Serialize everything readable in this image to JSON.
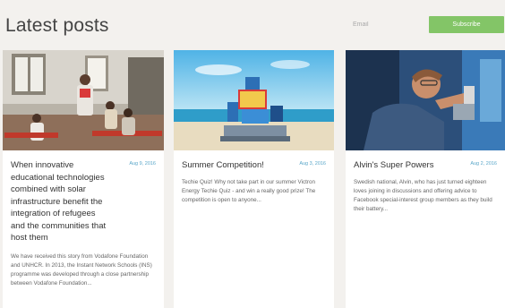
{
  "header": {
    "title": "Latest posts",
    "email_placeholder": "Email",
    "subscribe_label": "Subscribe"
  },
  "posts": [
    {
      "title": "When innovative educational technologies combined with solar infrastructure benefit the integration of refugees and the communities that host them",
      "date": "Aug 9, 2016",
      "excerpt": "We have received this story from Vodafone Foundation and UNHCR. In 2013, the Instant Network Schools (INS) programme was developed through a close partnership between Vodafone Foundation...",
      "image": "classroom-photo"
    },
    {
      "title": "Summer Competition!",
      "date": "Aug 3, 2016",
      "excerpt": "Techie Quiz! Why not take part in our summer Victron Energy Techie Quiz - and win a really good prize! The competition is open to anyone...",
      "image": "beach-product-photo"
    },
    {
      "title": "Alvin's Super Powers",
      "date": "Aug 2, 2016",
      "excerpt": "Swedish national, Alvin, who has just turned eighteen loves joining in discussions and offering advice to Facebook special-interest group members as they build their battery...",
      "image": "boy-electronics-photo"
    }
  ]
}
